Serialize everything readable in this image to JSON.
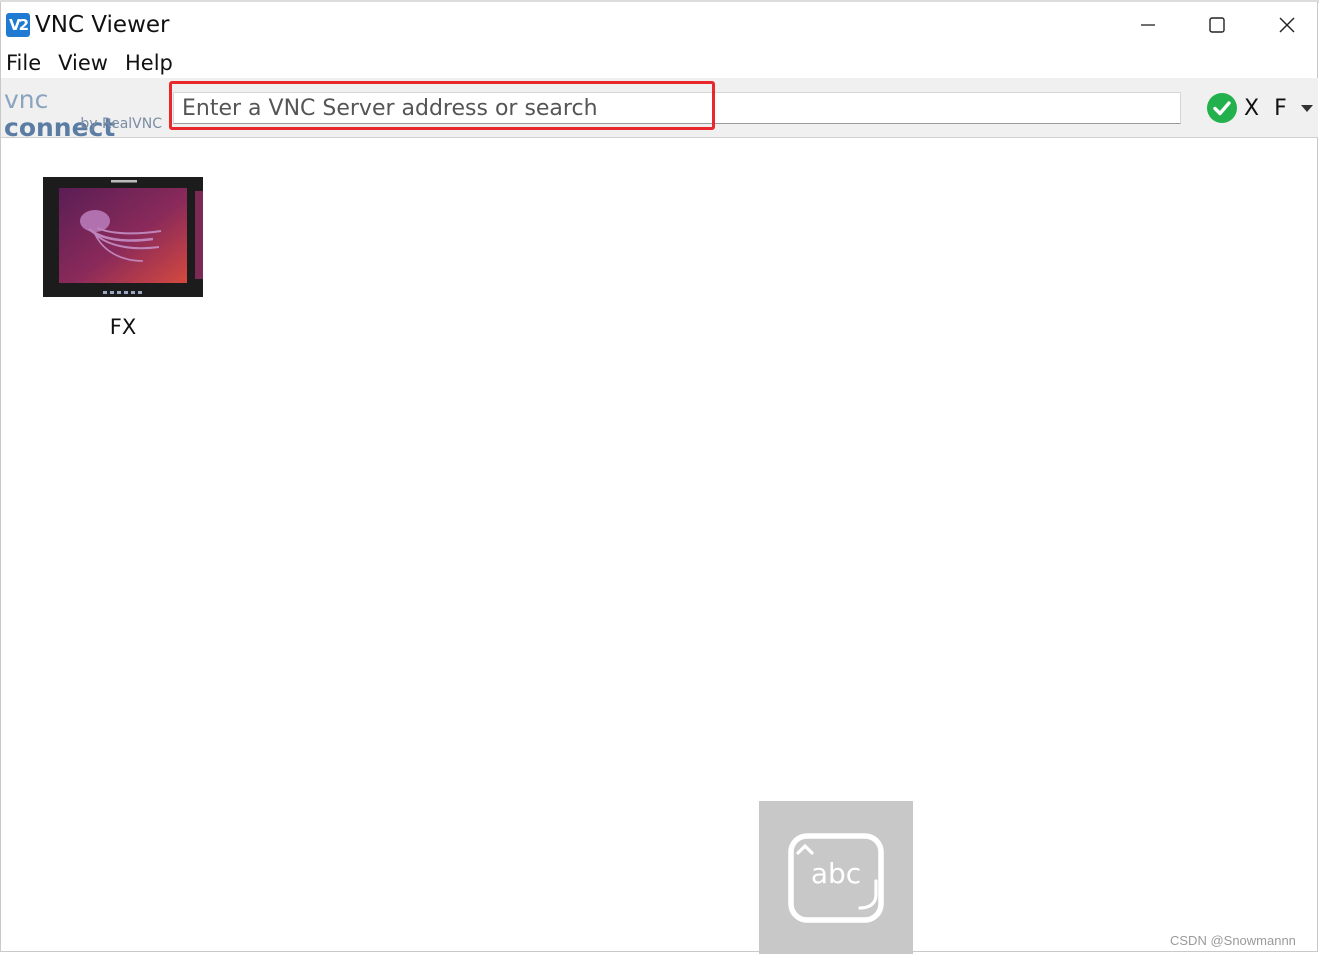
{
  "window": {
    "title": "VNC Viewer",
    "app_icon_text": "V2"
  },
  "menu": {
    "items": [
      "File",
      "View",
      "Help"
    ]
  },
  "toolbar": {
    "brand_main_vnc": "vnc",
    "brand_main_connect": "connect",
    "brand_sub": "by RealVNC",
    "search_placeholder": "Enter a VNC Server address or search",
    "search_value": "",
    "account_name": "X F"
  },
  "connections": [
    {
      "label": "FX"
    }
  ],
  "keyboard_overlay": {
    "text": "abc"
  },
  "watermark": "CSDN @Snowmannn",
  "colors": {
    "accent": "#1f7ad1",
    "highlight": "#e8282b",
    "status_ok": "#22b14c",
    "toolbar_bg": "#f0f0f0"
  }
}
